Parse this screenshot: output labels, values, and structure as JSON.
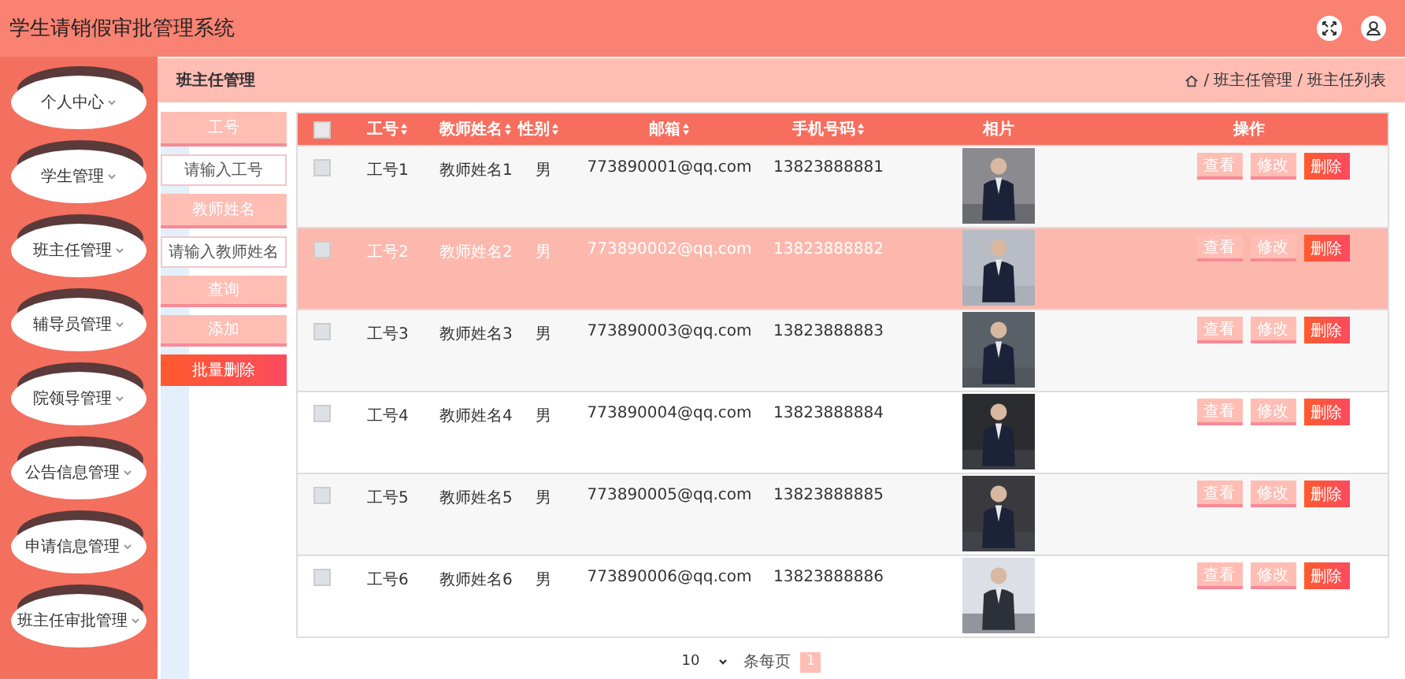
{
  "header": {
    "title": "学生请销假审批管理系统"
  },
  "sidebar": {
    "items": [
      {
        "label": "个人中心"
      },
      {
        "label": "学生管理"
      },
      {
        "label": "班主任管理"
      },
      {
        "label": "辅导员管理"
      },
      {
        "label": "院领导管理"
      },
      {
        "label": "公告信息管理"
      },
      {
        "label": "申请信息管理"
      },
      {
        "label": "班主任审批管理"
      }
    ]
  },
  "page": {
    "title": "班主任管理",
    "breadcrumb": {
      "separator": "/",
      "items": [
        "班主任管理",
        "班主任列表"
      ]
    }
  },
  "search_form": [
    {
      "kind": "label",
      "text": "工号"
    },
    {
      "kind": "input",
      "placeholder": "请输入工号"
    },
    {
      "kind": "label",
      "text": "教师姓名"
    },
    {
      "kind": "input",
      "placeholder": "请输入教师姓名"
    },
    {
      "kind": "button",
      "text": "查询"
    },
    {
      "kind": "button",
      "text": "添加"
    },
    {
      "kind": "danger",
      "text": "批量删除"
    }
  ],
  "table": {
    "select_all": {
      "checked": false
    },
    "columns": [
      {
        "label": "工号",
        "sortable": true
      },
      {
        "label": "教师姓名",
        "sortable": true
      },
      {
        "label": "性别",
        "sortable": true
      },
      {
        "label": "邮箱",
        "sortable": true
      },
      {
        "label": "手机号码",
        "sortable": true
      },
      {
        "label": "相片",
        "sortable": false
      },
      {
        "label": "操作",
        "sortable": false
      }
    ],
    "rows": [
      {
        "checked": false,
        "selected": false,
        "cells": [
          "工号1",
          "教师姓名1",
          "男",
          "773890001@qq.com",
          "13823888881"
        ],
        "photo": {
          "kind": "picture"
        },
        "actions": [
          {
            "label": "查看",
            "kind": "light"
          },
          {
            "label": "修改",
            "kind": "light"
          },
          {
            "label": "删除",
            "kind": "danger"
          }
        ]
      },
      {
        "checked": false,
        "selected": true,
        "cells": [
          "工号2",
          "教师姓名2",
          "男",
          "773890002@qq.com",
          "13823888882"
        ],
        "photo": {
          "kind": "picture"
        },
        "actions": [
          {
            "label": "查看",
            "kind": "light"
          },
          {
            "label": "修改",
            "kind": "light"
          },
          {
            "label": "删除",
            "kind": "danger"
          }
        ]
      },
      {
        "checked": false,
        "selected": false,
        "cells": [
          "工号3",
          "教师姓名3",
          "男",
          "773890003@qq.com",
          "13823888883"
        ],
        "photo": {
          "kind": "picture"
        },
        "actions": [
          {
            "label": "查看",
            "kind": "light"
          },
          {
            "label": "修改",
            "kind": "light"
          },
          {
            "label": "删除",
            "kind": "danger"
          }
        ]
      },
      {
        "checked": false,
        "selected": false,
        "cells": [
          "工号4",
          "教师姓名4",
          "男",
          "773890004@qq.com",
          "13823888884"
        ],
        "photo": {
          "kind": "picture"
        },
        "actions": [
          {
            "label": "查看",
            "kind": "light"
          },
          {
            "label": "修改",
            "kind": "light"
          },
          {
            "label": "删除",
            "kind": "danger"
          }
        ]
      },
      {
        "checked": false,
        "selected": false,
        "cells": [
          "工号5",
          "教师姓名5",
          "男",
          "773890005@qq.com",
          "13823888885"
        ],
        "photo": {
          "kind": "picture"
        },
        "actions": [
          {
            "label": "查看",
            "kind": "light"
          },
          {
            "label": "修改",
            "kind": "light"
          },
          {
            "label": "删除",
            "kind": "danger"
          }
        ]
      },
      {
        "checked": false,
        "selected": false,
        "cells": [
          "工号6",
          "教师姓名6",
          "男",
          "773890006@qq.com",
          "13823888886"
        ],
        "photo": {
          "kind": "picture"
        },
        "actions": [
          {
            "label": "查看",
            "kind": "light"
          },
          {
            "label": "修改",
            "kind": "light"
          },
          {
            "label": "删除",
            "kind": "danger"
          }
        ]
      }
    ]
  },
  "pagination": {
    "page_size": "10",
    "page_size_label": "条每页",
    "pages": [
      {
        "label": "1",
        "selected": true
      }
    ]
  }
}
